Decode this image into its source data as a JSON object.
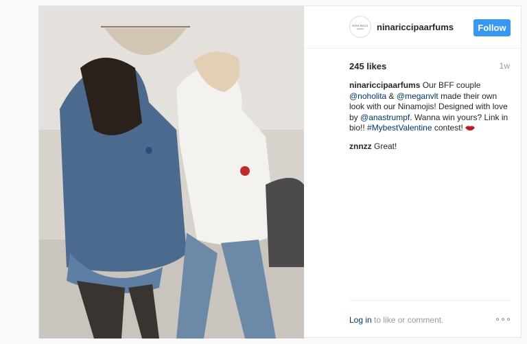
{
  "post": {
    "username": "ninariccipaarfums",
    "avatar_text_line1": "NINA RICCI",
    "avatar_text_line2": "parfums",
    "follow_label": "Follow",
    "likes": "245 likes",
    "age": "1w",
    "caption": {
      "user": "ninariccipaarfums",
      "p1": " Our BFF couple ",
      "mention1": "@noholita",
      "p2": " & ",
      "mention2": "@meganvlt",
      "p3": " made their own look with our Ninamojis! Designed with love by ",
      "mention3": "@anastrumpf",
      "p4": ". Wanna win yours? Link in bio!! ",
      "hashtag": "#MybestValentine",
      "p5": " contest! "
    },
    "comments": [
      {
        "user": "znnzz",
        "text": " Great!"
      }
    ],
    "footer": {
      "login_link": "Log in",
      "login_rest": " to like or comment."
    },
    "icons": {
      "more": "more-options-icon",
      "lips": "kiss-lips-emoji"
    },
    "colors": {
      "follow_button": "#3897f0",
      "link": "#003569",
      "muted": "#999999"
    }
  }
}
